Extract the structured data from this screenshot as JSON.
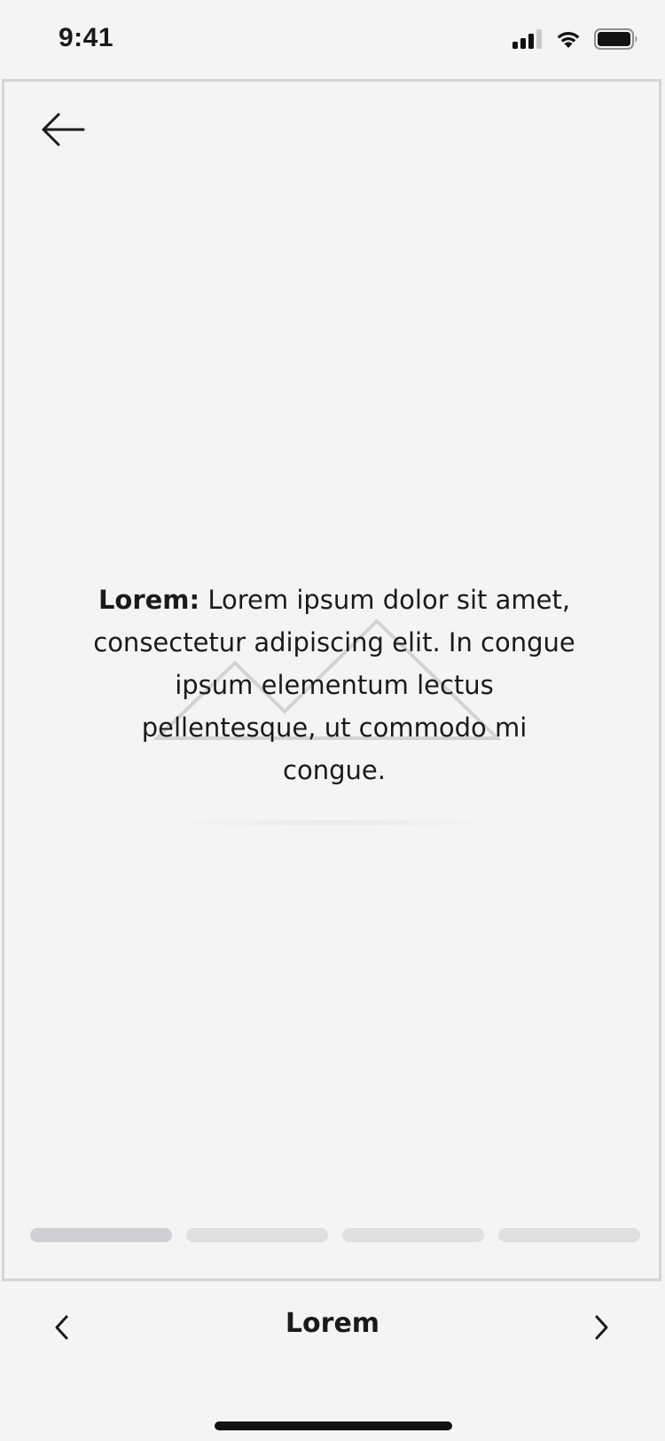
{
  "status_bar": {
    "time": "9:41",
    "icons": [
      "cellular-signal-icon",
      "wifi-icon",
      "battery-icon"
    ]
  },
  "header": {
    "back_icon": "arrow-left-icon"
  },
  "content": {
    "body_bold": "Lorem:",
    "body_text": " Lorem ipsum dolor sit amet, consectetur adipiscing elit. In congue ipsum elementum lectus pellentesque, ut commodo mi congue.",
    "image_icon": "mountain-image-placeholder-icon"
  },
  "progress": {
    "total_steps": 4,
    "active_step": 1
  },
  "bottom_nav": {
    "title": "Lorem",
    "prev_icon": "chevron-left-icon",
    "next_icon": "chevron-right-icon"
  },
  "colors": {
    "background": "#f4f4f4",
    "border": "#d5d5d8",
    "text": "#1a1a1a",
    "progress_active": "#d0d0d4",
    "progress_inactive": "#e0e0e2"
  }
}
